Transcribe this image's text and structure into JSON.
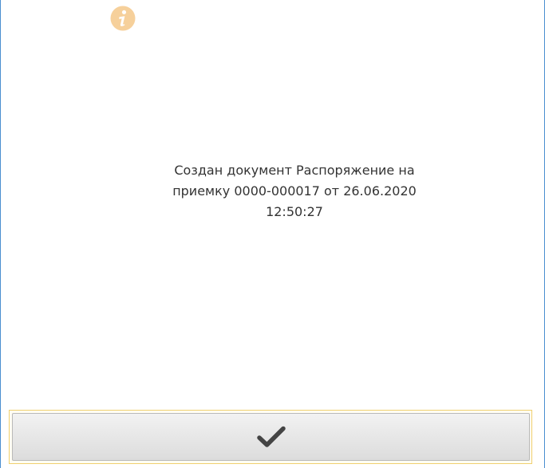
{
  "dialog": {
    "icon": "info-icon",
    "message_lines": [
      "Создан документ Распоряжение на",
      "приемку 0000-000017 от 26.06.2020",
      "12:50:27"
    ]
  },
  "buttons": {
    "ok_icon": "checkmark-icon"
  },
  "colors": {
    "info_icon": "#f6d09b",
    "frame_border": "#4a8fd0",
    "focus_outline": "#f0d070",
    "text": "#333333",
    "checkmark": "#444444"
  }
}
